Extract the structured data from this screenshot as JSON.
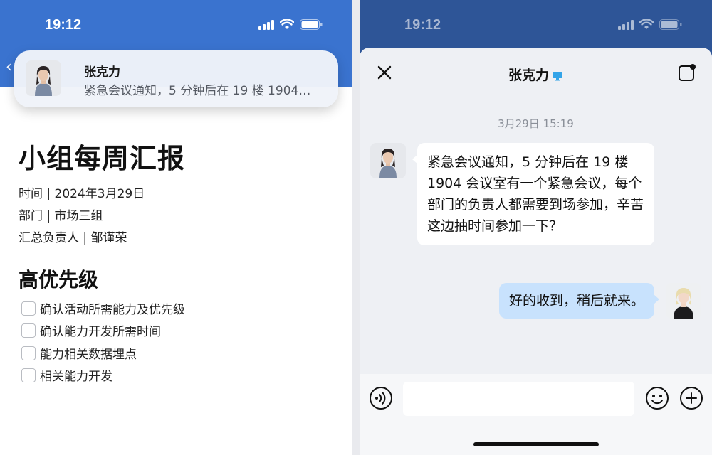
{
  "left": {
    "status": {
      "time": "19:12"
    },
    "banner": {
      "name": "张克力",
      "message": "紧急会议通知，5 分钟后在 19 楼 1904…"
    },
    "doc": {
      "title": "小组每周汇报",
      "meta": [
        "时间 | 2024年3月29日",
        "部门 | 市场三组",
        "汇总负责人 | 邹谨荣"
      ],
      "section_title": "高优先级",
      "todos": [
        "确认活动所需能力及优先级",
        "确认能力开发所需时间",
        "能力相关数据埋点",
        "相关能力开发"
      ]
    }
  },
  "right": {
    "status": {
      "time": "19:12"
    },
    "chat": {
      "title": "张克力",
      "timestamp": "3月29日 15:19",
      "incoming_message": "紧急会议通知，5 分钟后在 19 楼 1904 会议室有一个紧急会议，每个部门的负责人都需要到场参加，辛苦这边抽时间参加一下？",
      "outgoing_message": "好的收到，稍后就来。"
    },
    "input": {
      "placeholder": ""
    }
  },
  "colors": {
    "header_blue": "#3a73cf",
    "dim_blue": "#2e5597",
    "bubble_out": "#c8e2fd",
    "bubble_in": "#ffffff"
  },
  "icons": [
    "signal-icon",
    "wifi-icon",
    "battery-icon",
    "back-chevron-icon",
    "close-icon",
    "monitor-icon",
    "compose-icon",
    "voice-icon",
    "emoji-icon",
    "plus-icon"
  ]
}
